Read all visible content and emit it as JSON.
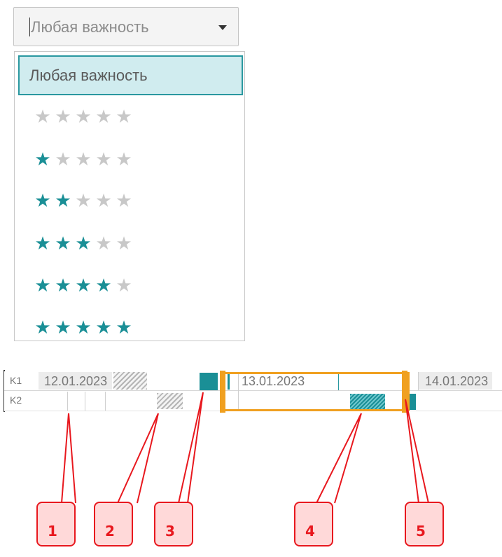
{
  "importance_select": {
    "value": "Любая важность",
    "options": [
      {
        "label": "Любая важность",
        "rating": null,
        "selected": true
      },
      {
        "rating": 0
      },
      {
        "rating": 1
      },
      {
        "rating": 2
      },
      {
        "rating": 3
      },
      {
        "rating": 4
      },
      {
        "rating": 5
      }
    ],
    "max_rating": 5
  },
  "timeline": {
    "rows": [
      "K1",
      "K2"
    ],
    "dates": [
      "12.01.2023",
      "13.01.2023",
      "14.01.2023"
    ]
  },
  "callouts": [
    "1",
    "2",
    "3",
    "4",
    "5"
  ],
  "colors": {
    "accent": "#1a8f96",
    "selection_bg": "#d0ecef",
    "highlight": "#f0a020",
    "callout": "#e8181e",
    "callout_bg": "#ffd9d9",
    "star_off": "#c8c8c8"
  }
}
